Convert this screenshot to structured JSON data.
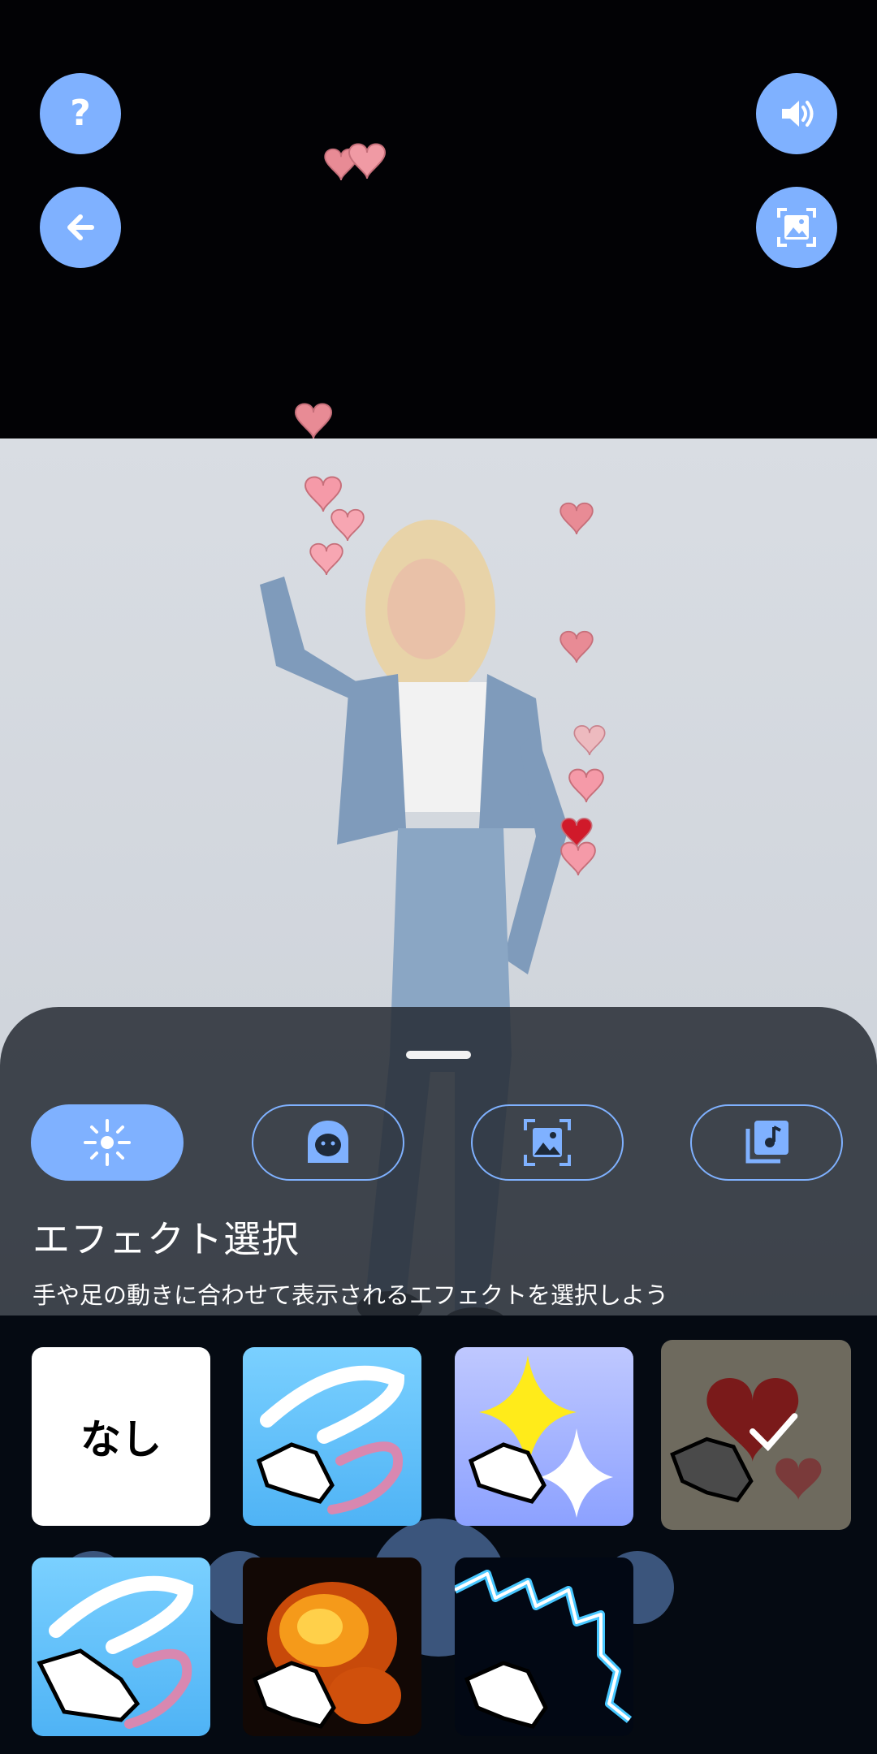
{
  "top_controls": {
    "help": "help-icon",
    "back": "back-arrow-icon",
    "sound": "speaker-icon",
    "gallery": "image-frame-icon"
  },
  "tabs": [
    {
      "id": "effect",
      "icon": "sparkle-icon",
      "active": true
    },
    {
      "id": "face",
      "icon": "face-icon",
      "active": false
    },
    {
      "id": "background",
      "icon": "image-frame-icon",
      "active": false
    },
    {
      "id": "music",
      "icon": "music-library-icon",
      "active": false
    }
  ],
  "sheet": {
    "title": "エフェクト選択",
    "subtitle": "手や足の動きに合わせて表示されるエフェクトを選択しよう"
  },
  "effects": [
    {
      "id": "none",
      "label": "なし",
      "selected": false
    },
    {
      "id": "hand-swoosh",
      "icon": "hand-swoosh-icon",
      "selected": false
    },
    {
      "id": "hand-sparkle",
      "icon": "hand-sparkle-icon",
      "selected": false
    },
    {
      "id": "hand-hearts",
      "icon": "hand-hearts-icon",
      "selected": true
    },
    {
      "id": "foot-swoosh",
      "icon": "foot-swoosh-icon",
      "selected": false
    },
    {
      "id": "hand-fire",
      "icon": "hand-fire-icon",
      "selected": false
    },
    {
      "id": "hand-lightning",
      "icon": "hand-lightning-icon",
      "selected": false
    }
  ],
  "colors": {
    "accent": "#7fb1ff",
    "sheet_bg": "#262c34",
    "grid_bg": "#050a12"
  }
}
